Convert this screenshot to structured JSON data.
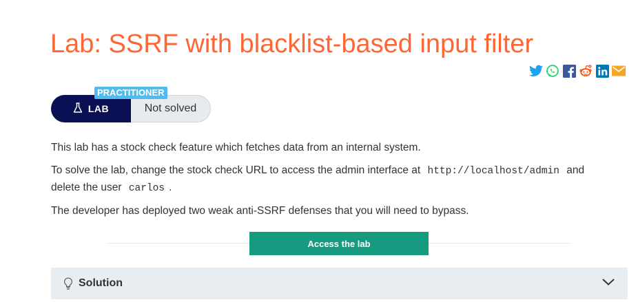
{
  "header": {
    "title": "Lab: SSRF with blacklist-based input filter"
  },
  "share": {
    "icons": [
      "twitter-icon",
      "whatsapp-icon",
      "facebook-icon",
      "reddit-icon",
      "linkedin-icon",
      "email-icon"
    ],
    "colors": {
      "twitter": "#1da1f2",
      "whatsapp": "#25d366",
      "facebook": "#3b5998",
      "reddit": "#ff4500",
      "linkedin": "#0077b5",
      "email": "#f5a623"
    }
  },
  "badge": {
    "level": "PRACTITIONER",
    "type_label": "LAB",
    "status": "Not solved"
  },
  "description": {
    "p1": "This lab has a stock check feature which fetches data from an internal system.",
    "p2_before": "To solve the lab, change the stock check URL to access the admin interface at",
    "p2_code1": "http://localhost/admin",
    "p2_middle": "and delete the user",
    "p2_code2": "carlos",
    "p2_after": ".",
    "p3": "The developer has deployed two weak anti-SSRF defenses that you will need to bypass."
  },
  "access_button": {
    "label": "Access the lab"
  },
  "solution": {
    "label": "Solution"
  },
  "colors": {
    "title": "#ff6633",
    "lab_pill": "#0a1054",
    "level_tag": "#4fbbee",
    "access_button": "#169a80",
    "solution_bg": "#e8edf1"
  }
}
